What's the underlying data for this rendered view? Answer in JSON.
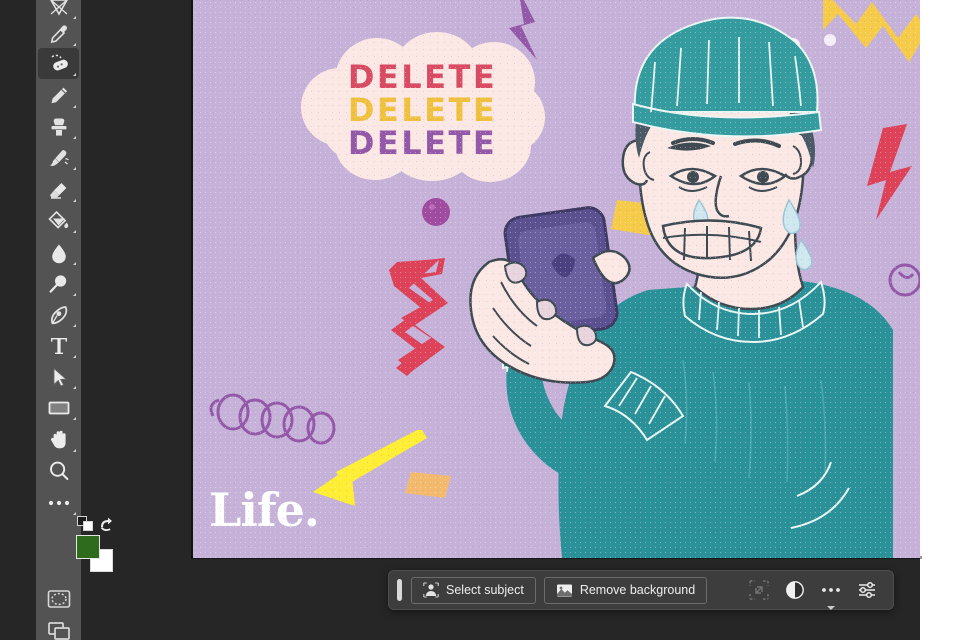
{
  "app": {
    "workspace_bg": "#262626",
    "panel_bg": "#535353",
    "canvas_bg": "#c6b2d8"
  },
  "tools": {
    "panel_name": "tools-panel",
    "selected": "spot-healing-brush",
    "items": [
      {
        "id": "crop-tool",
        "label": "Crop Tool",
        "icon": "crop-icon",
        "has_flyout": true
      },
      {
        "id": "eyedropper-tool",
        "label": "Eyedropper Tool",
        "icon": "eyedropper-icon",
        "has_flyout": true
      },
      {
        "id": "spot-healing-brush",
        "label": "Spot Healing Brush Tool",
        "icon": "healing-brush-icon",
        "has_flyout": true
      },
      {
        "id": "brush-tool",
        "label": "Brush Tool",
        "icon": "pencil-icon",
        "has_flyout": true
      },
      {
        "id": "clone-stamp-tool",
        "label": "Clone Stamp Tool",
        "icon": "stamp-icon",
        "has_flyout": true
      },
      {
        "id": "history-brush-tool",
        "label": "History Brush Tool",
        "icon": "history-brush-icon",
        "has_flyout": true
      },
      {
        "id": "eraser-tool",
        "label": "Eraser Tool",
        "icon": "eraser-icon",
        "has_flyout": true
      },
      {
        "id": "gradient-tool",
        "label": "Gradient Tool",
        "icon": "paint-bucket-icon",
        "has_flyout": true
      },
      {
        "id": "blur-tool",
        "label": "Blur Tool",
        "icon": "water-drop-icon",
        "has_flyout": true
      },
      {
        "id": "dodge-tool",
        "label": "Dodge Tool",
        "icon": "dodge-icon",
        "has_flyout": true
      },
      {
        "id": "pen-tool",
        "label": "Pen Tool",
        "icon": "pen-nib-icon",
        "has_flyout": true
      },
      {
        "id": "type-tool",
        "label": "Horizontal Type Tool",
        "icon": "type-t-icon",
        "has_flyout": true
      },
      {
        "id": "path-selection-tool",
        "label": "Path Selection Tool",
        "icon": "arrow-cursor-icon",
        "has_flyout": true
      },
      {
        "id": "rectangle-tool",
        "label": "Rectangle Tool",
        "icon": "rectangle-icon",
        "has_flyout": true
      },
      {
        "id": "hand-tool",
        "label": "Hand Tool",
        "icon": "hand-icon",
        "has_flyout": true
      },
      {
        "id": "zoom-tool",
        "label": "Zoom Tool",
        "icon": "magnifier-icon",
        "has_flyout": false
      },
      {
        "id": "edit-toolbar",
        "label": "Edit Toolbar",
        "icon": "ellipsis-icon",
        "has_flyout": true
      }
    ],
    "colors": {
      "foreground": "#2f6b1c",
      "background": "#ffffff",
      "default_colors_label": "Default Foreground and Background Colors",
      "swap_label": "Switch Foreground and Background Colors"
    },
    "quick_mask_label": "Edit in Quick Mask Mode",
    "screen_mode_label": "Change Screen Mode"
  },
  "artwork": {
    "bubble_lines": [
      {
        "text": "DELETE",
        "color": "#d94b63"
      },
      {
        "text": "DELETE",
        "color": "#f0c03f"
      },
      {
        "text": "DELETE",
        "color": "#9458a8"
      }
    ],
    "bubble_fill": "#fbe8e4",
    "logo_text": "Life.",
    "logo_color": "#ffffff",
    "annotation_arrow_color": "#ffee33",
    "character": {
      "beanie_color": "#349b9e",
      "sweater_color": "#2b9198",
      "skin_color": "#fbe8e4",
      "hair_color": "#4a5a66",
      "phone_color": "#5b5190"
    },
    "decorations": [
      {
        "shape": "zigzag",
        "color": "#dd4259"
      },
      {
        "shape": "zigzag",
        "color": "#f6cb4a"
      },
      {
        "shape": "circle",
        "color": "#9e4ba0"
      },
      {
        "shape": "bar",
        "color": "#f6cb4a"
      },
      {
        "shape": "spiral",
        "color": "#9458a8"
      },
      {
        "shape": "bolt",
        "color": "#9458a8"
      }
    ]
  },
  "taskbar": {
    "name": "contextual-task-bar",
    "drag_handle_label": "Drag task bar",
    "select_subject_label": "Select subject",
    "remove_background_label": "Remove background",
    "buttons": [
      {
        "id": "select-subject",
        "label": "Select subject",
        "icon": "subject-person-icon",
        "enabled": true
      },
      {
        "id": "remove-background",
        "label": "Remove background",
        "icon": "image-photo-icon",
        "enabled": true
      }
    ],
    "icons": [
      {
        "id": "transform-selection",
        "icon": "transform-selection-icon",
        "enabled": false
      },
      {
        "id": "adjustment",
        "icon": "half-circle-icon",
        "enabled": true
      },
      {
        "id": "more-options",
        "icon": "ellipsis-icon",
        "enabled": true,
        "has_caret": true
      },
      {
        "id": "task-bar-properties",
        "icon": "sliders-icon",
        "enabled": true
      }
    ]
  }
}
